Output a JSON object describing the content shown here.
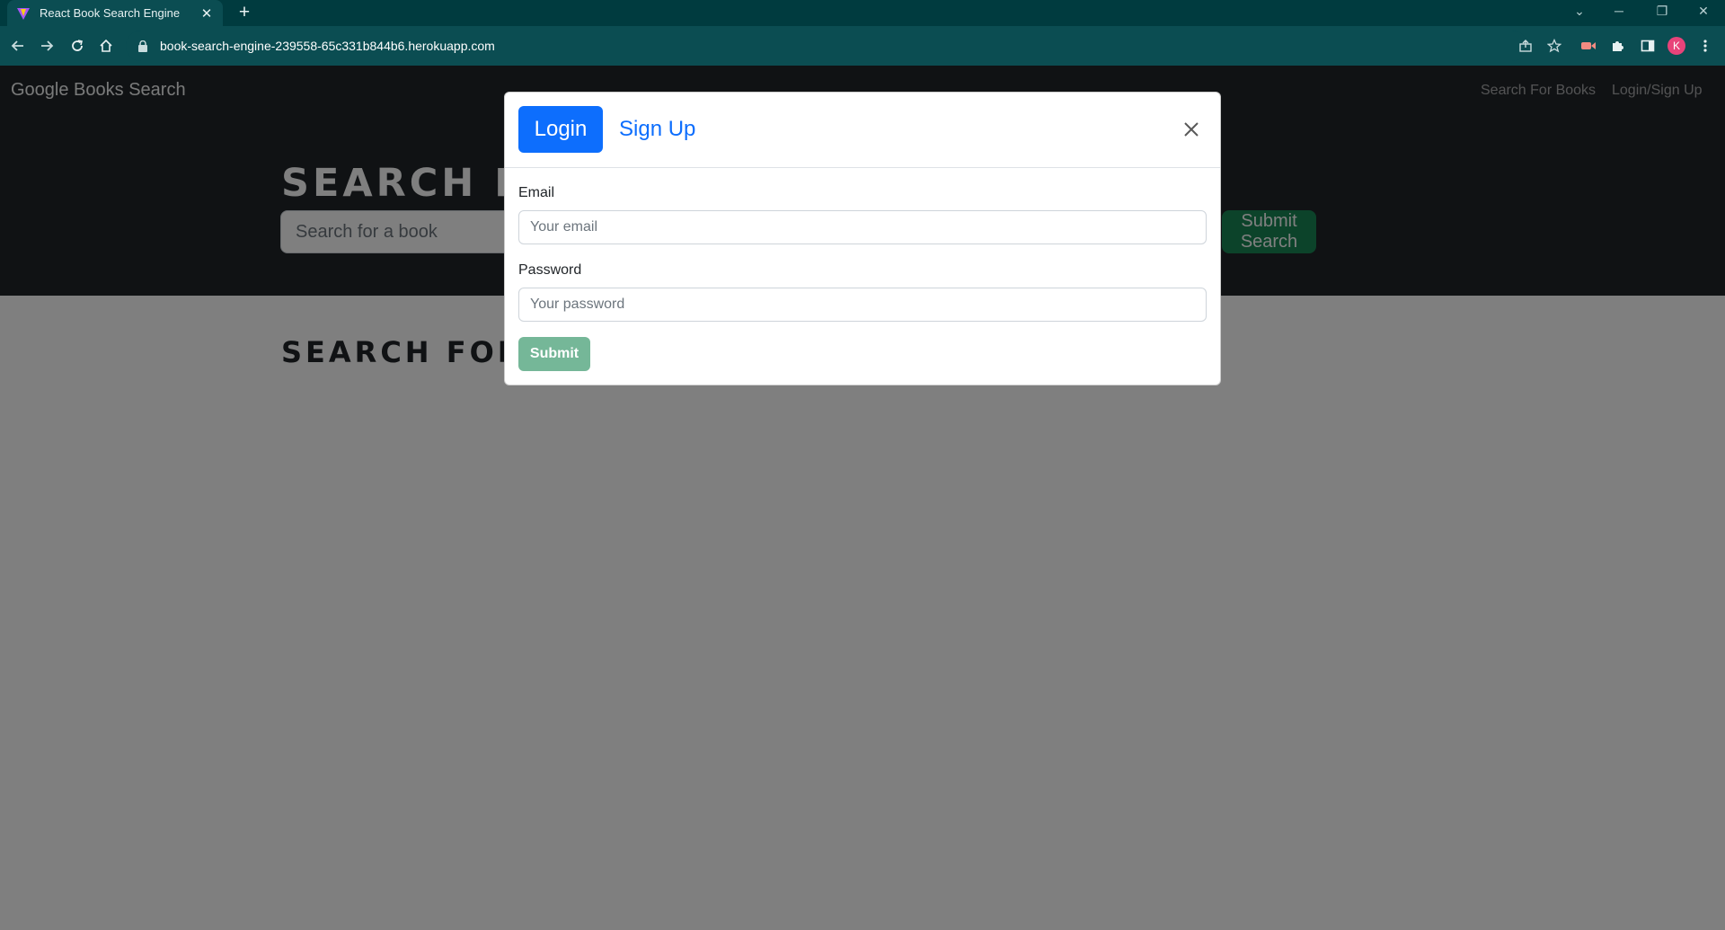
{
  "browser": {
    "tab_title": "React Book Search Engine",
    "url": "book-search-engine-239558-65c331b844b6.herokuapp.com",
    "profile_initial": "K"
  },
  "navbar": {
    "brand": "Google Books Search",
    "links": [
      "Search For Books",
      "Login/Sign Up"
    ]
  },
  "hero": {
    "title": "SEARCH FOR BOOKS!",
    "search_placeholder": "Search for a book",
    "submit_label": "Submit Search"
  },
  "results": {
    "title": "SEARCH FOR A BOOK TO BEGIN"
  },
  "modal": {
    "tabs": [
      "Login",
      "Sign Up"
    ],
    "active_tab": "Login",
    "email_label": "Email",
    "email_placeholder": "Your email",
    "password_label": "Password",
    "password_placeholder": "Your password",
    "submit_label": "Submit"
  },
  "colors": {
    "primary": "#0d6efd",
    "success_disabled": "#75b798",
    "navbar_bg": "#212529",
    "browser_frame": "#003b3f"
  }
}
